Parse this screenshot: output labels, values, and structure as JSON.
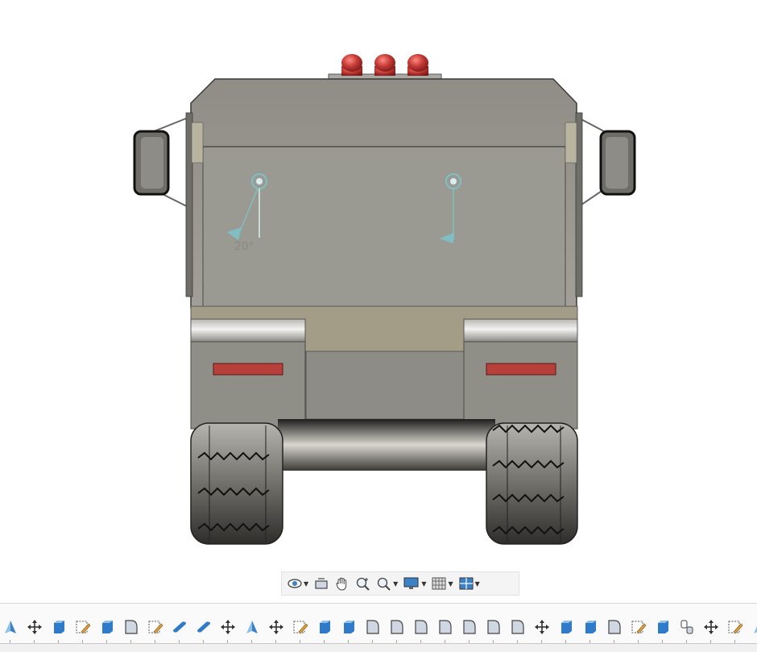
{
  "viewport": {
    "sketch_dimension": "20°",
    "colors": {
      "body": "#98978d",
      "body_dark": "#7a7973",
      "stripe": "#a09a86",
      "beacon": "#c43a36",
      "reflector": "#b8403a",
      "tire": "#4a4945",
      "sketch": "#7fbfc3"
    }
  },
  "nav_toolbar": {
    "buttons": [
      {
        "name": "orbit-icon",
        "dropdown": true
      },
      {
        "name": "look-at-icon",
        "dropdown": false
      },
      {
        "name": "pan-icon",
        "dropdown": false
      },
      {
        "name": "zoom-icon",
        "dropdown": false
      },
      {
        "name": "fit-icon",
        "dropdown": true
      },
      {
        "name": "display-settings-icon",
        "dropdown": true
      },
      {
        "name": "grid-icon",
        "dropdown": true
      },
      {
        "name": "viewports-icon",
        "dropdown": true
      }
    ]
  },
  "timeline": {
    "items": [
      "triangle",
      "move",
      "box",
      "sketch",
      "box",
      "fillet",
      "sketch",
      "cylinder",
      "cylinder",
      "move",
      "triangle",
      "move",
      "sketch",
      "box",
      "box",
      "fillet",
      "fillet",
      "fillet",
      "fillet",
      "fillet",
      "fillet",
      "fillet",
      "move",
      "box",
      "box",
      "fillet",
      "sketch",
      "box",
      "joint",
      "move",
      "sketch",
      "triangle"
    ]
  }
}
